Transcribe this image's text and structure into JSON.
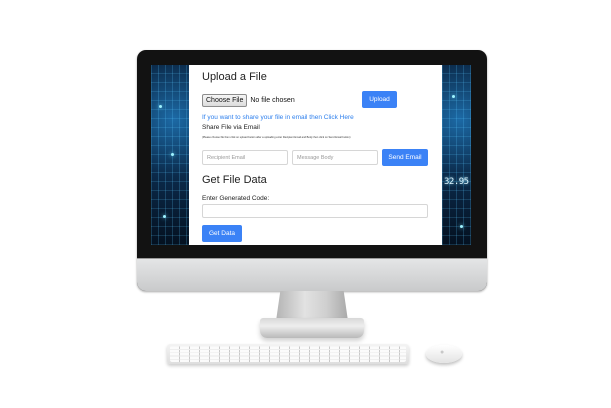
{
  "upload": {
    "title": "Upload a File",
    "choose_button": "Choose File",
    "file_status": "No file chosen",
    "upload_button": "Upload"
  },
  "share": {
    "email_link": "If you want to share your file in email then Click Here",
    "title": "Share File via Email",
    "help_text": "(Please choose file then click on upload button after a uploading enter Recipient Email and Body then click on Send Email button)",
    "recipient_placeholder": "Recipient Email",
    "message_placeholder": "Message Body",
    "send_button": "Send Email"
  },
  "get": {
    "title": "Get File Data",
    "code_label": "Enter Generated Code:",
    "code_value": "",
    "get_button": "Get Data"
  },
  "background": {
    "digits": "32.95"
  },
  "colors": {
    "accent": "#3b82f6",
    "link": "#2f80ed"
  },
  "icons": {
    "mouse_logo": "apple-icon"
  }
}
